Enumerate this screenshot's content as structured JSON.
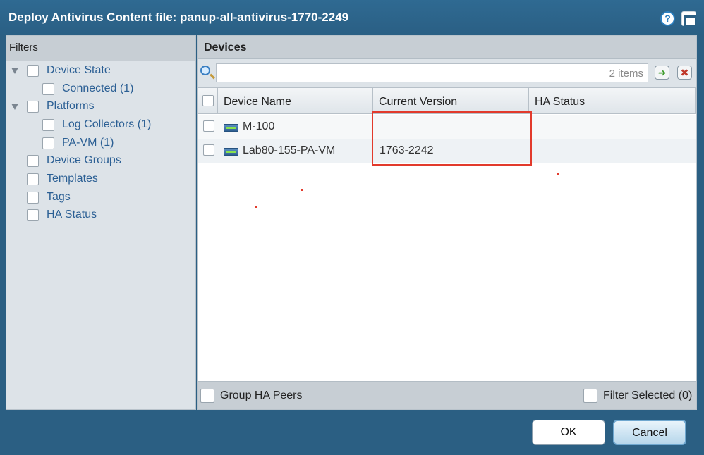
{
  "dialog": {
    "title": "Deploy Antivirus Content file: panup-all-antivirus-1770-2249",
    "help_icon": "help-icon",
    "maximize_icon": "maximize-icon"
  },
  "filters": {
    "header": "Filters",
    "items": [
      {
        "label": "Device State",
        "expandable": true
      },
      {
        "label": "Connected (1)",
        "expandable": false
      },
      {
        "label": "Platforms",
        "expandable": true
      },
      {
        "label": "Log Collectors (1)",
        "expandable": false
      },
      {
        "label": "PA-VM (1)",
        "expandable": false
      },
      {
        "label": "Device Groups",
        "expandable": false
      },
      {
        "label": "Templates",
        "expandable": false
      },
      {
        "label": "Tags",
        "expandable": false
      },
      {
        "label": "HA Status",
        "expandable": false
      }
    ]
  },
  "devices": {
    "header": "Devices",
    "search": {
      "value": "",
      "count_text": "2 items"
    },
    "columns": [
      "Device Name",
      "Current Version",
      "HA Status"
    ],
    "rows": [
      {
        "device_name": "M-100",
        "current_version": "",
        "ha_status": ""
      },
      {
        "device_name": "Lab80-155-PA-VM",
        "current_version": "1763-2242",
        "ha_status": ""
      }
    ],
    "group_ha_peers": "Group HA Peers",
    "filter_selected": "Filter Selected (0)"
  },
  "buttons": {
    "ok": "OK",
    "cancel": "Cancel"
  },
  "colors": {
    "titlebar": "#2b5f83",
    "link": "#2b5f94",
    "highlight_box": "#e23a2c"
  }
}
